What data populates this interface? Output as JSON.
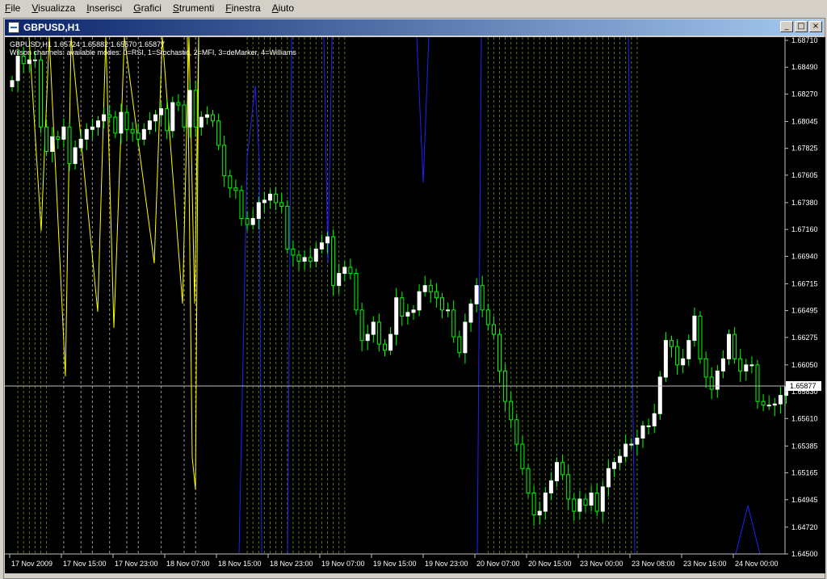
{
  "menu": [
    "File",
    "Visualizza",
    "Inserisci",
    "Grafici",
    "Strumenti",
    "Finestra",
    "Aiuto"
  ],
  "window": {
    "title": "GBPUSD,H1"
  },
  "window_buttons": [
    "_",
    "□",
    "×"
  ],
  "info": {
    "line1": "GBPUSD,H1  1.65724 1.65882 1.65570 1.65877",
    "line2": "Wilson channels: available modes: 0=RSI, 1=Stochastic, 2=MFI, 3=deMarker, 4=Williams"
  },
  "colors": {
    "background": "#000000",
    "bull": "#ffffff",
    "bear": "#00ff00",
    "yellow": "#ffff00",
    "blue": "#2020ff",
    "current": "#c0c0c0"
  },
  "chart_data": {
    "type": "candlestick",
    "symbol": "GBPUSD",
    "timeframe": "H1",
    "ylim": [
      1.645,
      1.6871
    ],
    "y_ticks": [
      1.6871,
      1.6849,
      1.6827,
      1.68045,
      1.67825,
      1.67605,
      1.6738,
      1.6716,
      1.6694,
      1.66715,
      1.66495,
      1.66275,
      1.6605,
      1.6583,
      1.6561,
      1.65385,
      1.65165,
      1.64945,
      1.6472,
      1.645
    ],
    "y_tick_labels": [
      "1.68710",
      "1.68490",
      "1.68270",
      "1.68045",
      "1.67825",
      "1.67605",
      "1.67380",
      "1.67160",
      "1.66940",
      "1.66715",
      "1.66495",
      "1.66275",
      "1.66050",
      "1.65830",
      "1.65610",
      "1.65385",
      "1.65165",
      "1.64945",
      "1.64720",
      "1.64500"
    ],
    "x_tick_labels": [
      "17 Nov 2009",
      "17 Nov 15:00",
      "17 Nov 23:00",
      "18 Nov 07:00",
      "18 Nov 15:00",
      "18 Nov 23:00",
      "19 Nov 07:00",
      "19 Nov 15:00",
      "19 Nov 23:00",
      "20 Nov 07:00",
      "20 Nov 15:00",
      "23 Nov 00:00",
      "23 Nov 08:00",
      "23 Nov 16:00",
      "24 Nov 00:00"
    ],
    "current_price": 1.65877,
    "current_price_label": "1.65877",
    "closes": [
      1.6838,
      1.6858,
      1.6852,
      1.6855,
      1.6855,
      1.68,
      1.678,
      1.6792,
      1.679,
      1.68,
      1.677,
      1.6783,
      1.679,
      1.6798,
      1.68,
      1.6805,
      1.681,
      1.6808,
      1.6795,
      1.6812,
      1.6798,
      1.6795,
      1.679,
      1.6798,
      1.6805,
      1.681,
      1.6815,
      1.6797,
      1.682,
      1.6818,
      1.68,
      1.683,
      1.68,
      1.6808,
      1.681,
      1.6805,
      1.6785,
      1.676,
      1.675,
      1.6748,
      1.6725,
      1.672,
      1.6725,
      1.6738,
      1.674,
      1.6745,
      1.6738,
      1.6735,
      1.67,
      1.6695,
      1.669,
      1.6693,
      1.669,
      1.67,
      1.6705,
      1.671,
      1.667,
      1.668,
      1.6685,
      1.668,
      1.665,
      1.6625,
      1.663,
      1.664,
      1.6622,
      1.6617,
      1.663,
      1.666,
      1.6645,
      1.6648,
      1.665,
      1.6665,
      1.667,
      1.6665,
      1.666,
      1.665,
      1.665,
      1.6628,
      1.6615,
      1.664,
      1.6655,
      1.667,
      1.665,
      1.6638,
      1.663,
      1.66,
      1.6575,
      1.656,
      1.654,
      1.652,
      1.65,
      1.6482,
      1.6485,
      1.65,
      1.651,
      1.6525,
      1.6515,
      1.6495,
      1.6485,
      1.6495,
      1.649,
      1.65,
      1.6485,
      1.6505,
      1.652,
      1.6525,
      1.653,
      1.654,
      1.654,
      1.6545,
      1.6555,
      1.6555,
      1.6565,
      1.6595,
      1.6625,
      1.662,
      1.6605,
      1.661,
      1.6625,
      1.6645,
      1.661,
      1.6595,
      1.6585,
      1.66,
      1.661,
      1.663,
      1.661,
      1.66,
      1.6605,
      1.6605,
      1.6575,
      1.6572,
      1.6572,
      1.6573,
      1.658,
      1.6587
    ]
  }
}
